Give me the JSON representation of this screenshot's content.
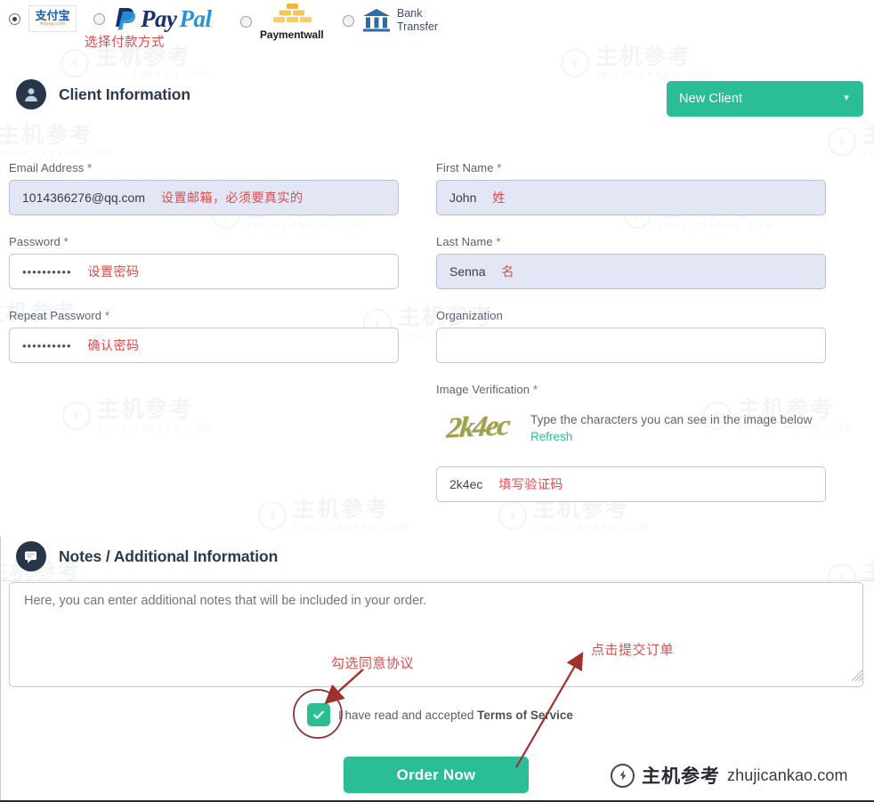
{
  "payment_methods": {
    "annotation": "选择付款方式",
    "options": [
      {
        "id": "alipay",
        "label_cn": "支付宝",
        "label_en": "Alipay.com",
        "icon": "alipay-logo",
        "selected": true
      },
      {
        "id": "paypal",
        "label": "PayPal",
        "label_part1": "Pay",
        "label_part2": "Pal",
        "icon": "paypal-logo",
        "selected": false
      },
      {
        "id": "paymentwall",
        "label": "Paymentwall",
        "icon": "gold-bars-icon",
        "selected": false
      },
      {
        "id": "bank_transfer",
        "label_line1": "Bank",
        "label_line2": "Transfer",
        "icon": "bank-building-icon",
        "selected": false
      }
    ]
  },
  "client_section": {
    "title": "Client Information",
    "icon": "user-circle-icon",
    "new_client_button": {
      "label": "New Client",
      "caret": "▼",
      "color": "#2bbd96"
    }
  },
  "form": {
    "email": {
      "label": "Email Address",
      "required": "*",
      "value": "1014366276@qq.com",
      "annotation": "设置邮箱，必须要真实的"
    },
    "password": {
      "label": "Password",
      "required": "*",
      "value": "••••••••••",
      "annotation": "设置密码"
    },
    "repeat_password": {
      "label": "Repeat Password",
      "required": "*",
      "value": "••••••••••",
      "annotation": "确认密码"
    },
    "first_name": {
      "label": "First Name",
      "required": "*",
      "value": "John",
      "annotation": "姓"
    },
    "last_name": {
      "label": "Last Name",
      "required": "*",
      "value": "Senna",
      "annotation": "名"
    },
    "organization": {
      "label": "Organization",
      "required": "",
      "value": ""
    },
    "image_verification": {
      "label": "Image Verification",
      "required": "*",
      "captcha_text": "2k4ec",
      "hint": "Type the characters you can see in the image below",
      "refresh_label": "Refresh",
      "input_value": "2k4ec",
      "annotation": "填写验证码"
    }
  },
  "notes_section": {
    "title": "Notes / Additional Information",
    "icon": "chat-bubble-icon",
    "placeholder": "Here, you can enter additional notes that will be included in your order."
  },
  "terms": {
    "checkbox_checked": true,
    "label_prefix": "I have read and accepted ",
    "link_label": "Terms of Service",
    "annotation": "勾选同意协议"
  },
  "submit": {
    "label": "Order Now",
    "annotation": "点击提交订单",
    "color": "#2bbd96"
  },
  "branding": {
    "cn": "主机参考",
    "en": "zhujicankao.com",
    "watermark_cn": "主机参考",
    "watermark_en": "ZHUJICANKAO.COM"
  }
}
